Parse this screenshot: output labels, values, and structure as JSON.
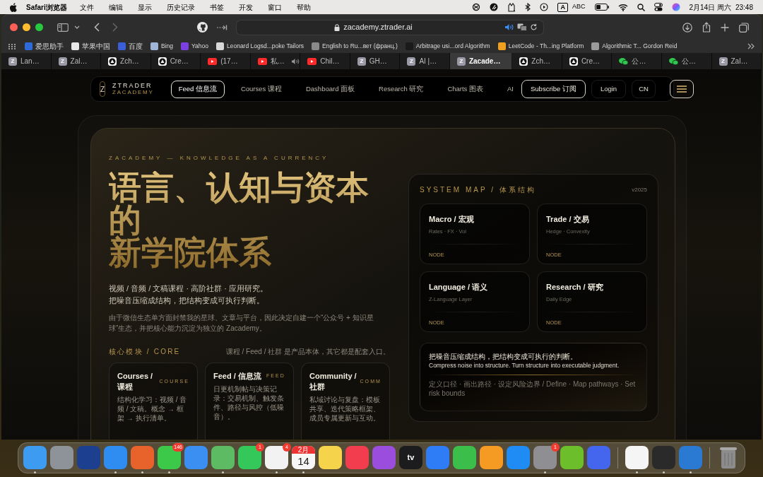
{
  "menubar": {
    "app": "Safari浏览器",
    "menus": [
      "文件",
      "编辑",
      "显示",
      "历史记录",
      "书签",
      "开发",
      "窗口",
      "帮助"
    ],
    "input_letter": "A",
    "input_name": "ABC",
    "date": "2月14日 周六",
    "time": "23:48"
  },
  "toolbar": {
    "url": "zacademy.ztrader.ai"
  },
  "bookmarks": [
    {
      "label": "爱思助手",
      "color": "#2f6bd8"
    },
    {
      "label": "苹果中国",
      "color": "#e8e8e8"
    },
    {
      "label": "百度",
      "color": "#3b5fd9"
    },
    {
      "label": "Bing",
      "color": "#9fb6d8"
    },
    {
      "label": "Yahoo",
      "color": "#7b3fe4"
    },
    {
      "label": "Leonard Logsd...poke Tailors",
      "color": "#d8d8d8"
    },
    {
      "label": "English to Ru...вет (франц.)",
      "color": "#8a8a8a"
    },
    {
      "label": "Arbitrage usi...ord Algorithm",
      "color": "#1a1a1a"
    },
    {
      "label": "LeetCode - Th...ing Platform",
      "color": "#f0a020"
    },
    {
      "label": "Algorithmic T... Gordon Reid",
      "color": "#9a9a9a"
    }
  ],
  "tabs": [
    {
      "label": "Lan…",
      "kind": "letter",
      "favicon_text": "Z",
      "selected": false,
      "audio": false
    },
    {
      "label": "Zal…",
      "kind": "letter",
      "favicon_text": "Z",
      "selected": false,
      "audio": false
    },
    {
      "label": "Zch…",
      "kind": "triangle",
      "selected": false,
      "audio": false
    },
    {
      "label": "Cre…",
      "kind": "triangle",
      "selected": false,
      "audio": false
    },
    {
      "label": "(17…",
      "kind": "video",
      "selected": false,
      "audio": false
    },
    {
      "label": "私…",
      "kind": "video",
      "selected": false,
      "audio": true
    },
    {
      "label": "Chil…",
      "kind": "video",
      "selected": false,
      "audio": false
    },
    {
      "label": "GH…",
      "kind": "letter",
      "favicon_text": "Z",
      "selected": false,
      "audio": false
    },
    {
      "label": "AI |…",
      "kind": "letter",
      "favicon_text": "Z",
      "selected": false,
      "audio": false
    },
    {
      "label": "Zacade…",
      "kind": "letter",
      "favicon_text": "Z",
      "selected": true,
      "audio": false
    },
    {
      "label": "Zch…",
      "kind": "triangle",
      "selected": false,
      "audio": false
    },
    {
      "label": "Cre…",
      "kind": "triangle",
      "selected": false,
      "audio": false
    },
    {
      "label": "公…",
      "kind": "chat",
      "selected": false,
      "audio": false
    },
    {
      "label": "公…",
      "kind": "chat",
      "selected": false,
      "audio": false
    },
    {
      "label": "Zal…",
      "kind": "letter",
      "favicon_text": "Z",
      "selected": false,
      "audio": false
    }
  ],
  "nav": {
    "logo": "Z",
    "brand": "ZTRADER",
    "sub_brand": "ZACADEMY",
    "items": [
      {
        "label": "Feed 信息流",
        "selected": true
      },
      {
        "label": "Courses 课程",
        "selected": false
      },
      {
        "label": "Dashboard 面板",
        "selected": false
      },
      {
        "label": "Research 研究",
        "selected": false
      },
      {
        "label": "Charts 图表",
        "selected": false
      },
      {
        "label": "AI",
        "selected": false
      }
    ],
    "subscribe": "Subscribe 订阅",
    "login": "Login",
    "language": "CN"
  },
  "hero": {
    "eyebrow": "ZACADEMY — KNOWLEDGE AS A CURRENCY",
    "title_lines": [
      "语言、认知与资本的",
      "新学院体系"
    ],
    "lead_lines": [
      "视频 / 音频 / 文稿课程 · 高阶社群 · 应用研究。",
      "把噪音压缩成结构，把结构变成可执行判断。"
    ],
    "note": "由于微信生态单方面封禁我的星球、文章与平台，因此决定自建一个“公众号 + 知识星球”生态，并把核心能力沉淀为独立的 Zacademy。",
    "core_label": "核心模块 / CORE",
    "core_note": "课程 / Feed / 社群 是产品本体，其它都是配套入口。",
    "modules": [
      {
        "title": "Courses / 课程",
        "tag": "COURSE",
        "body": "结构化学习：视频 / 音频 / 文稿。概念 → 框架 → 执行清单。"
      },
      {
        "title": "Feed / 信息流",
        "tag": "FEED",
        "body": "日更机制帖与决策记录：交易机制、触发条件、路径与风控（低噪音）。"
      },
      {
        "title": "Community / 社群",
        "tag": "COMM",
        "body": "私域讨论与复盘：模板共享、迭代策略框架、成员专属更新与互动。"
      }
    ]
  },
  "system_map": {
    "title": "SYSTEM MAP / 体系结构",
    "version": "v2025",
    "nodes": [
      {
        "title": "Macro / 宏观",
        "subtitle": "Rates · FX · Vol",
        "tag": "NODE"
      },
      {
        "title": "Trade / 交易",
        "subtitle": "Hedge · Convexity",
        "tag": "NODE"
      },
      {
        "title": "Language / 语义",
        "subtitle": "Z-Language Layer",
        "tag": "NODE"
      },
      {
        "title": "Research / 研究",
        "subtitle": "Daily Edge",
        "tag": "NODE"
      }
    ],
    "summary": {
      "cn": "把噪音压缩成结构，把结构变成可执行的判断。",
      "en": "Compress noise into structure. Turn structure into executable judgment.",
      "footer": "定义口径 · 画出路径 · 设定风险边界 / Define · Map pathways · Set risk bounds"
    }
  },
  "dock": {
    "apps": [
      {
        "color": "#3d9bf2",
        "running": true
      },
      {
        "color": "#8e9399",
        "running": false
      },
      {
        "color": "#1d3f8f",
        "running": false
      },
      {
        "color": "#2f8df2",
        "running": true
      },
      {
        "color": "#e8622b",
        "running": true
      },
      {
        "color": "#3cc94a",
        "running": true,
        "badge": "146"
      },
      {
        "color": "#3b8ef2",
        "running": false
      },
      {
        "color": "#5dbb63",
        "running": true
      },
      {
        "color": "#34c759",
        "running": false,
        "badge": "1"
      },
      {
        "color": "#f2f2f2",
        "running": true,
        "badge": "4"
      },
      {
        "color": "#f7f7f7",
        "running": true,
        "label_top": "2月",
        "label": "14"
      },
      {
        "color": "#f5d34a",
        "running": false
      },
      {
        "color": "#f23d4f",
        "running": false
      },
      {
        "color": "#9b4dde",
        "running": false
      },
      {
        "color": "#1c1c1e",
        "running": false,
        "label": "tv"
      },
      {
        "color": "#2f7df6",
        "running": false
      },
      {
        "color": "#3cbf4a",
        "running": false
      },
      {
        "color": "#f59a23",
        "running": false
      },
      {
        "color": "#1f8bf5",
        "running": false
      },
      {
        "color": "#8e8e93",
        "running": true,
        "badge": "1"
      },
      {
        "color": "#6cbf2a",
        "running": false
      },
      {
        "color": "#4466ee",
        "running": false
      }
    ],
    "pinned": [
      {
        "color": "#f5f5f5",
        "running": true
      },
      {
        "color": "#2a2a2a",
        "running": true
      },
      {
        "color": "#2a7ad4",
        "running": true
      }
    ]
  }
}
